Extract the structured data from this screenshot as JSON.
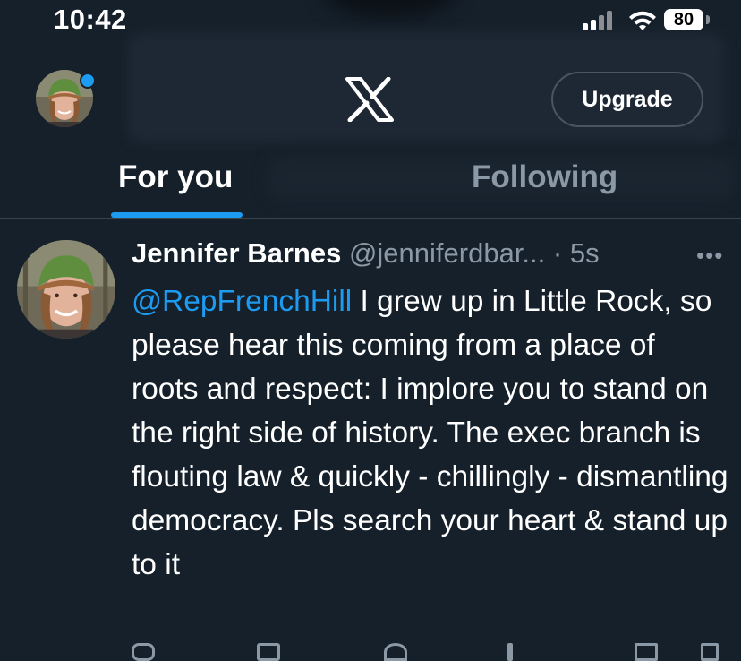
{
  "status_bar": {
    "time": "10:42",
    "battery": "80"
  },
  "top_bar": {
    "upgrade_label": "Upgrade",
    "logo": "x-logo-icon"
  },
  "tabs": [
    {
      "label": "For you",
      "active": true
    },
    {
      "label": "Following",
      "active": false
    }
  ],
  "tweet": {
    "name": "Jennifer Barnes",
    "handle": "@jenniferdbar...",
    "separator": " · ",
    "time": "5s",
    "mention": "@RepFrenchHill",
    "text": " I grew up in Little Rock, so please hear this coming from a place of roots and respect: I implore you to stand on the right side of history. The exec branch is flouting law & quickly - chillingly - dismantling democracy. Pls search your heart & stand up to it"
  },
  "colors": {
    "background": "#15202b",
    "accent": "#1d9bf0",
    "muted": "#8b98a5"
  },
  "icons": [
    "signal-icon",
    "wifi-icon",
    "battery-icon",
    "more-icon",
    "reply-icon",
    "retweet-icon",
    "like-icon",
    "views-icon",
    "bookmark-icon",
    "share-icon"
  ]
}
